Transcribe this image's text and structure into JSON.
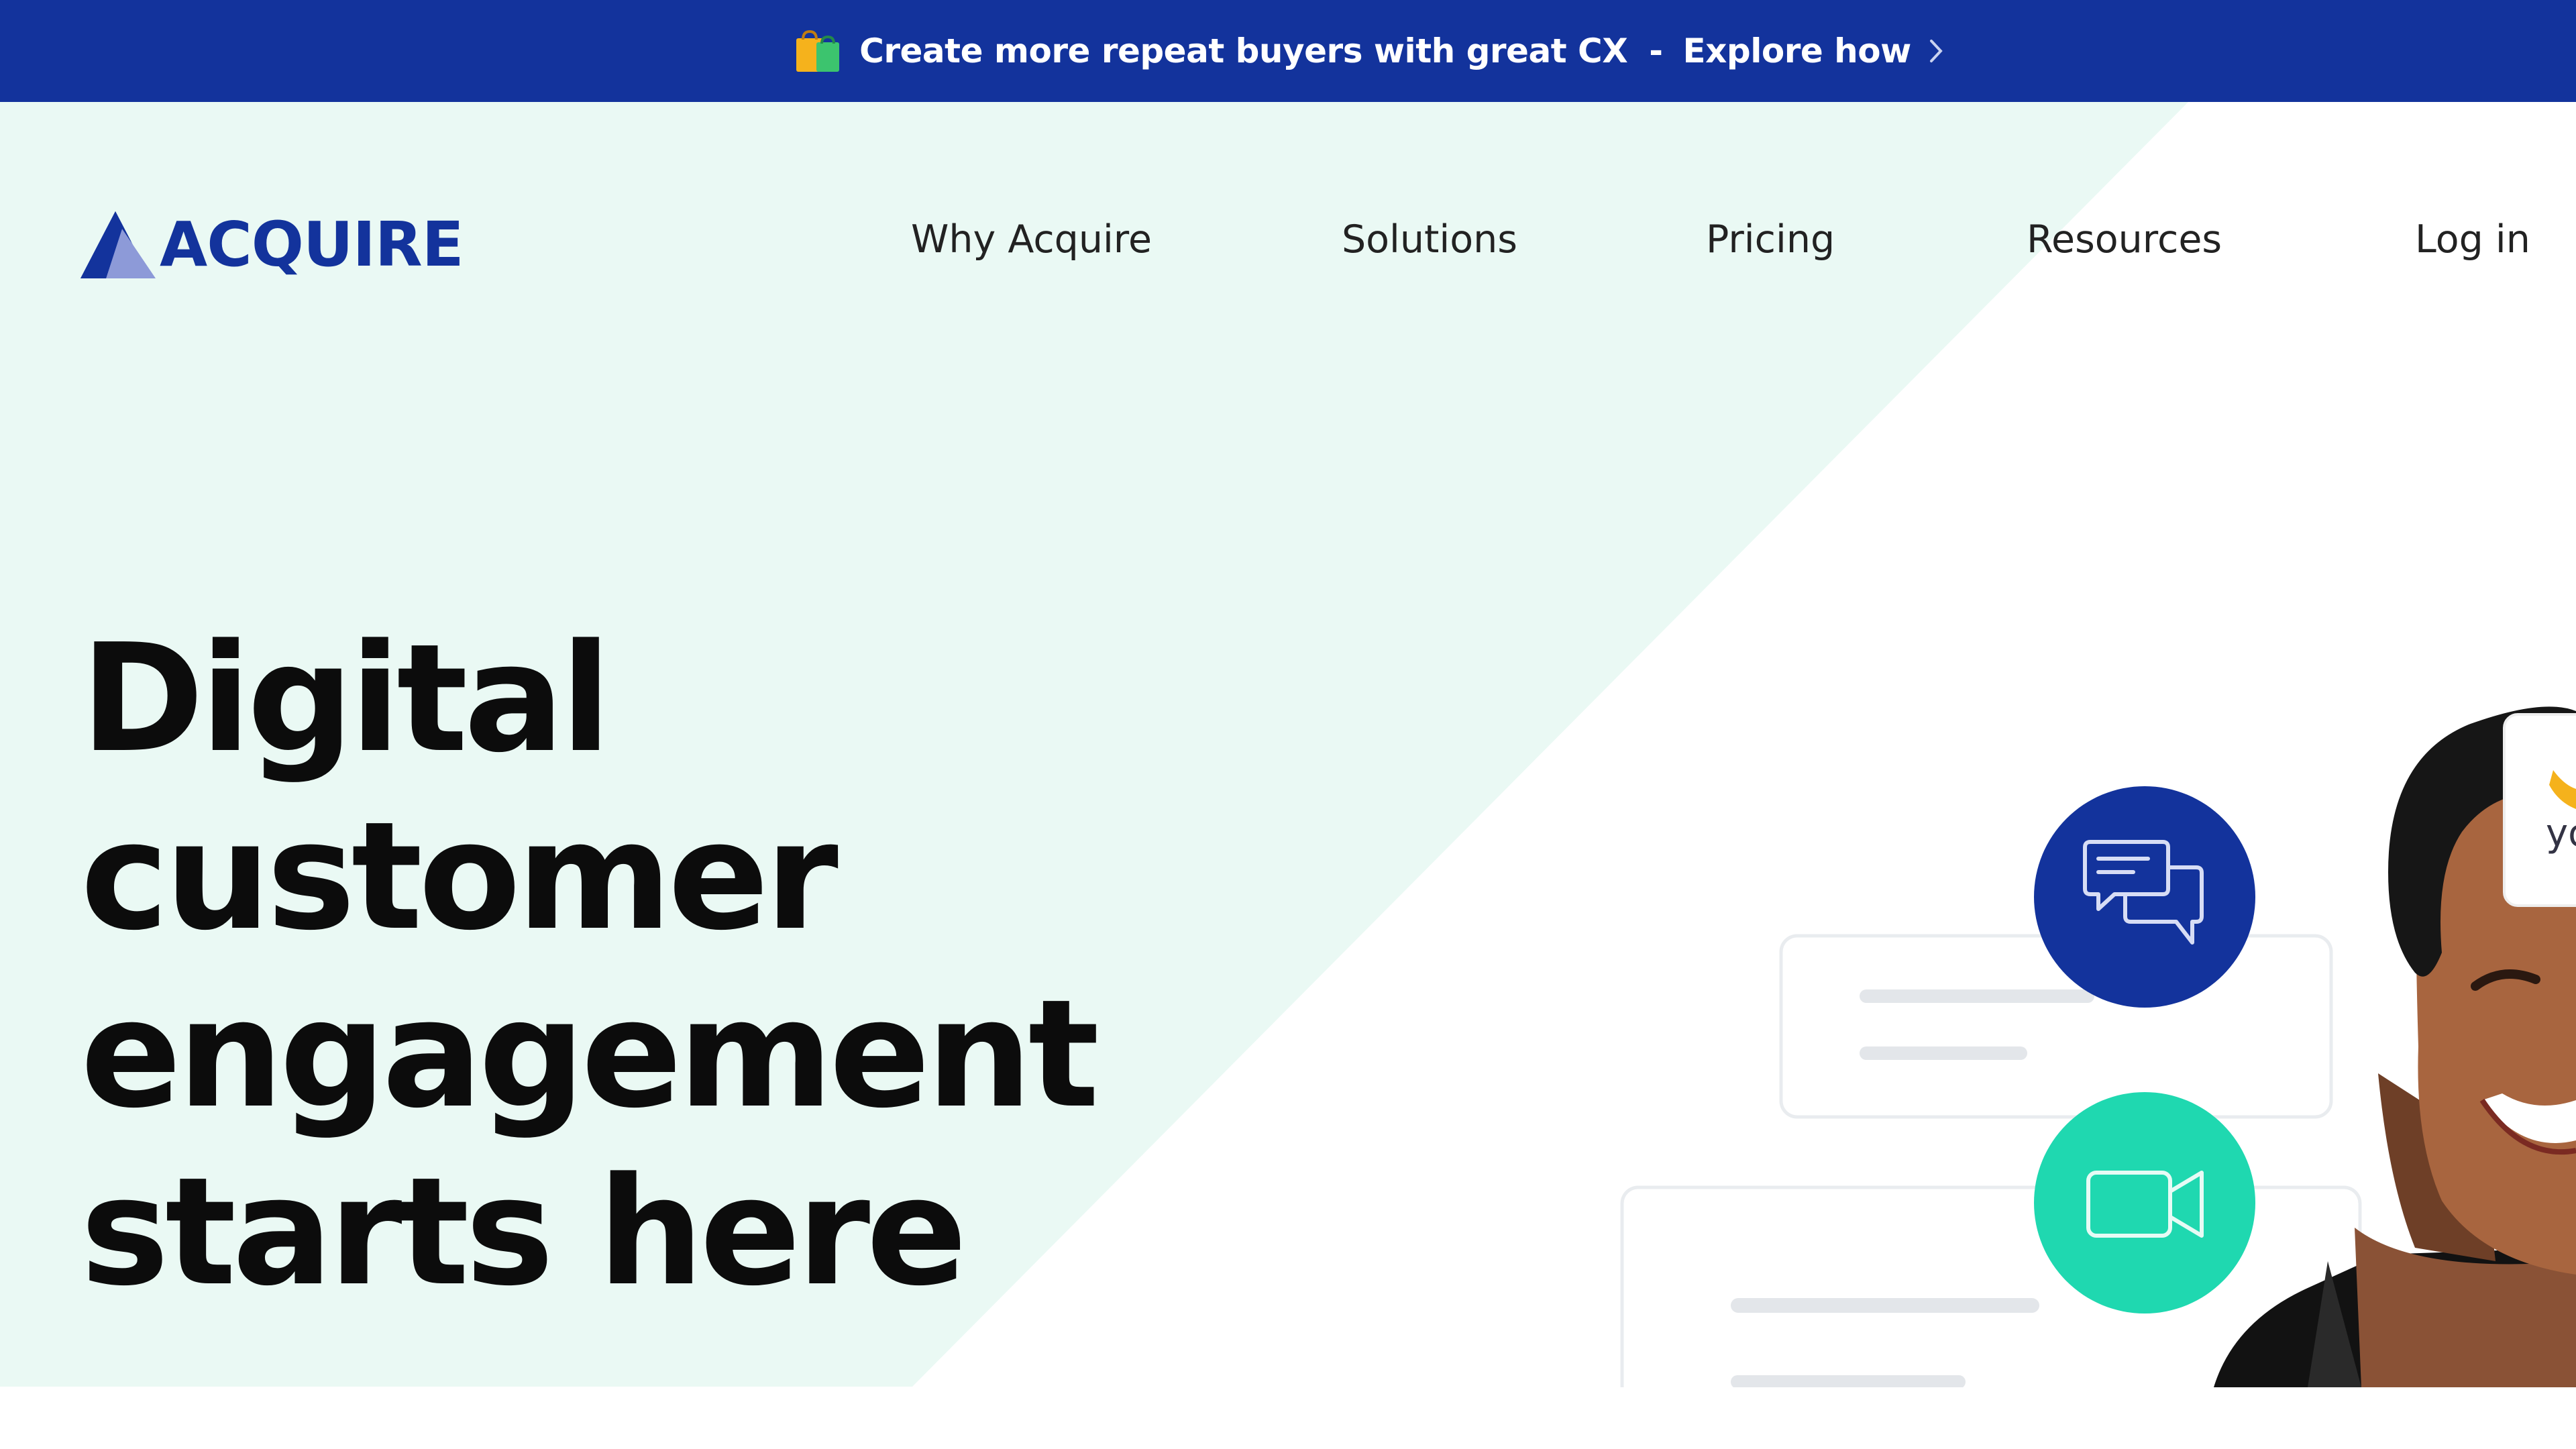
{
  "announcement": {
    "text": "Create more repeat buyers with great CX",
    "separator": "-",
    "link_label": "Explore how",
    "icon": "shopping-bag-icon"
  },
  "brand": {
    "name": "ACQUIRE",
    "primary_color": "#13339c",
    "accent_color": "#1fd8b0",
    "hero_tint": "#eaf9f4"
  },
  "nav": {
    "items": [
      {
        "label": "Why Acquire"
      },
      {
        "label": "Solutions"
      },
      {
        "label": "Pricing"
      },
      {
        "label": "Resources"
      },
      {
        "label": "Log in"
      }
    ]
  },
  "hero": {
    "headline_lines": [
      "Digital",
      "customer",
      "engagement",
      "starts here"
    ]
  },
  "illustration": {
    "chat_icon": "chat-bubbles-icon",
    "video_icon": "video-camera-icon",
    "partial_card_text": "yo"
  }
}
